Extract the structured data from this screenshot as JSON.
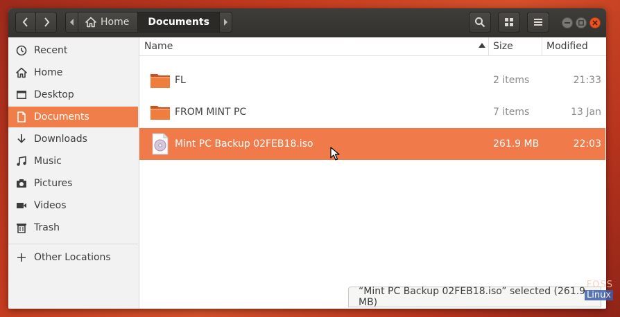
{
  "header": {
    "path": {
      "home_label": "Home",
      "current_label": "Documents"
    }
  },
  "sidebar": {
    "items": [
      {
        "label": "Recent",
        "icon": "clock-icon"
      },
      {
        "label": "Home",
        "icon": "home-icon"
      },
      {
        "label": "Desktop",
        "icon": "desktop-icon"
      },
      {
        "label": "Documents",
        "icon": "document-icon",
        "active": true
      },
      {
        "label": "Downloads",
        "icon": "download-icon"
      },
      {
        "label": "Music",
        "icon": "music-icon"
      },
      {
        "label": "Pictures",
        "icon": "camera-icon"
      },
      {
        "label": "Videos",
        "icon": "video-icon"
      },
      {
        "label": "Trash",
        "icon": "trash-icon"
      },
      {
        "label": "Other Locations",
        "icon": "plus-icon"
      }
    ]
  },
  "columns": {
    "name": "Name",
    "size": "Size",
    "modified": "Modified"
  },
  "files": [
    {
      "name": "FL",
      "size": "2 items",
      "modified": "21:33",
      "type": "folder"
    },
    {
      "name": "FROM MINT PC",
      "size": "7 items",
      "modified": "13 Jan",
      "type": "folder"
    },
    {
      "name": "Mint PC Backup 02FEB18.iso",
      "size": "261.9 MB",
      "modified": "22:03",
      "type": "disc-image",
      "selected": true
    }
  ],
  "status": {
    "text": "“Mint PC Backup 02FEB18.iso” selected  (261.9 MB)"
  },
  "watermark": {
    "top": "FOSS",
    "bottom": "Linux"
  },
  "colors": {
    "accent": "#e95420",
    "selection": "#f07a4a",
    "headerbar": "#3a3935"
  }
}
